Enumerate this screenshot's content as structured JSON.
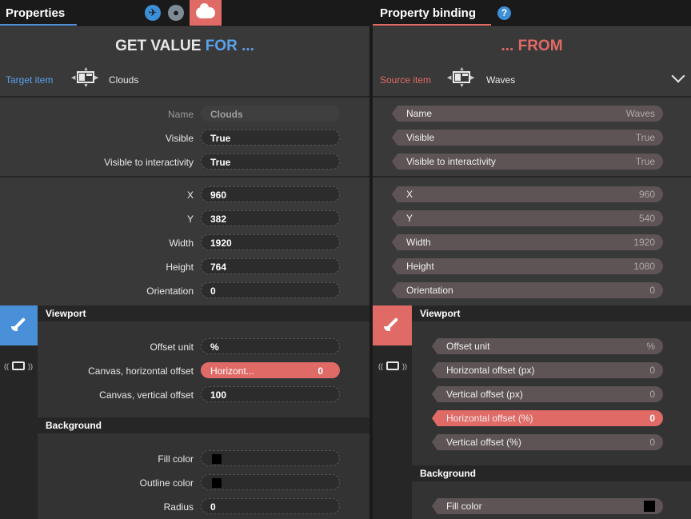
{
  "tabs": {
    "properties": "Properties",
    "binding": "Property binding"
  },
  "toolbar": {
    "icons": [
      "plane-icon",
      "globe-icon",
      "cloud-icon",
      "help-icon"
    ],
    "help_glyph": "?"
  },
  "left": {
    "title_prefix": "GET VALUE",
    "title_suffix": "FOR ...",
    "target_label": "Target item",
    "target_value": "Clouds",
    "general": [
      {
        "label": "Name",
        "value": "Clouds"
      },
      {
        "label": "Visible",
        "value": "True"
      },
      {
        "label": "Visible to interactivity",
        "value": "True"
      }
    ],
    "geometry": [
      {
        "label": "X",
        "value": "960"
      },
      {
        "label": "Y",
        "value": "382"
      },
      {
        "label": "Width",
        "value": "1920"
      },
      {
        "label": "Height",
        "value": "764"
      },
      {
        "label": "Orientation",
        "value": "0"
      }
    ],
    "viewport_title": "Viewport",
    "viewport": [
      {
        "label": "Offset unit",
        "value": "%"
      },
      {
        "label": "Canvas, horizontal offset",
        "value": "Horizont...",
        "bound_value": "0"
      },
      {
        "label": "Canvas, vertical offset",
        "value": "100"
      }
    ],
    "background_title": "Background",
    "background": [
      {
        "label": "Fill color",
        "value": ""
      },
      {
        "label": "Outline color",
        "value": ""
      },
      {
        "label": "Radius",
        "value": "0"
      }
    ]
  },
  "right": {
    "title": "... FROM",
    "source_label": "Source item",
    "source_value": "Waves",
    "general": [
      {
        "label": "Name",
        "value": "Waves"
      },
      {
        "label": "Visible",
        "value": "True"
      },
      {
        "label": "Visible to interactivity",
        "value": "True"
      }
    ],
    "geometry": [
      {
        "label": "X",
        "value": "960"
      },
      {
        "label": "Y",
        "value": "540"
      },
      {
        "label": "Width",
        "value": "1920"
      },
      {
        "label": "Height",
        "value": "1080"
      },
      {
        "label": "Orientation",
        "value": "0"
      }
    ],
    "viewport_title": "Viewport",
    "viewport": [
      {
        "label": "Offset unit",
        "value": "%"
      },
      {
        "label": "Horizontal offset (px)",
        "value": "0"
      },
      {
        "label": "Vertical offset (px)",
        "value": "0"
      },
      {
        "label": "Horizontal offset (%)",
        "value": "0"
      },
      {
        "label": "Vertical offset (%)",
        "value": "0"
      }
    ],
    "background_title": "Background",
    "background": [
      {
        "label": "Fill color",
        "value": ""
      }
    ]
  },
  "colors": {
    "accent_blue": "#4a90d9",
    "accent_red": "#e06a66",
    "panel_bg": "#393939"
  }
}
